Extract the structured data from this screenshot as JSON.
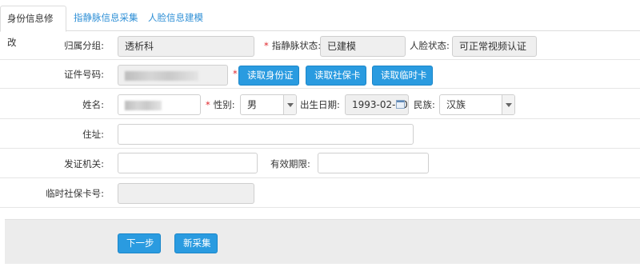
{
  "tabs": [
    {
      "label": "身份信息修改",
      "active": true
    },
    {
      "label": "指静脉信息采集",
      "active": false
    },
    {
      "label": "人脸信息建模",
      "active": false
    }
  ],
  "form": {
    "group": {
      "label": "归属分组:",
      "value": "透析科"
    },
    "vein_status": {
      "label": "指静脉状态:",
      "value": "已建模",
      "required": "*"
    },
    "face_status": {
      "label": "人脸状态:",
      "value": "可正常视频认证"
    },
    "id_number": {
      "label": "证件号码:",
      "value": "",
      "required": "*"
    },
    "read_id_card": "读取身份证",
    "read_social_card": "读取社保卡",
    "read_temp_card": "读取临时卡",
    "name": {
      "label": "姓名:",
      "value": "",
      "required": "*"
    },
    "gender": {
      "label": "性别:",
      "value": "男",
      "required": "*"
    },
    "birthdate": {
      "label": "出生日期:",
      "value": "1993-02-10"
    },
    "ethnicity": {
      "label": "民族:",
      "value": "汉族"
    },
    "address": {
      "label": "住址:",
      "value": ""
    },
    "issuer": {
      "label": "发证机关:",
      "value": ""
    },
    "validity": {
      "label": "有效期限:",
      "value": ""
    },
    "temp_social_card": {
      "label": "临时社保卡号:",
      "value": ""
    }
  },
  "actions": {
    "next": "下一步",
    "recollect": "新采集"
  },
  "colors": {
    "accent": "#2a9be0",
    "required": "#e0262b",
    "tab_link": "#2e8fd6"
  }
}
